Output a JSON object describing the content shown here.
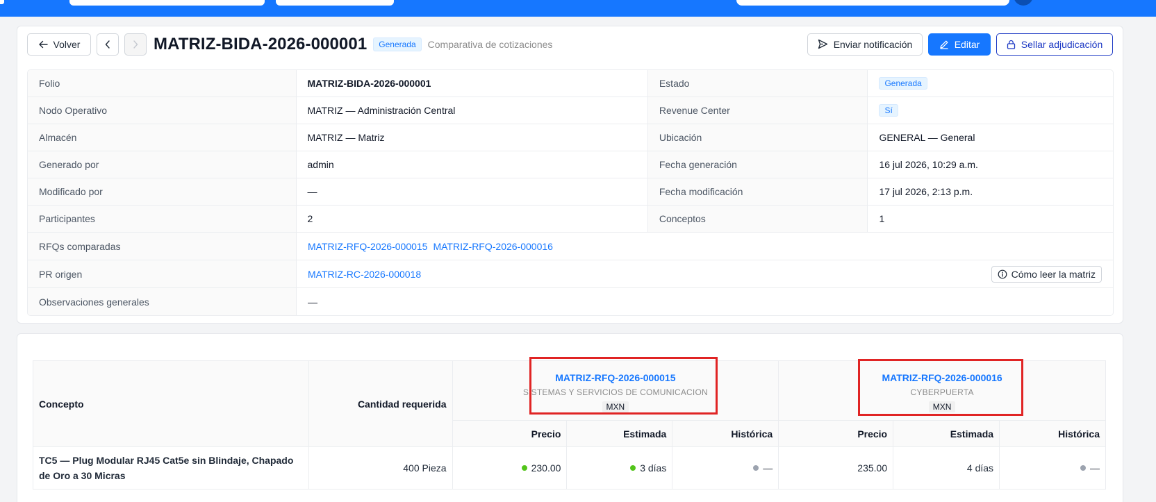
{
  "header": {
    "back_label": "Volver",
    "title": "MATRIZ-BIDA-2026-000001",
    "status": "Generada",
    "subtitle": "Comparativa de cotizaciones",
    "notify_label": "Enviar notificación",
    "edit_label": "Editar",
    "seal_label": "Sellar adjudicación"
  },
  "details": {
    "folio_label": "Folio",
    "folio": "MATRIZ-BIDA-2026-000001",
    "estado_label": "Estado",
    "estado": "Generada",
    "nodo_label": "Nodo Operativo",
    "nodo": "MATRIZ — Administración Central",
    "revenue_label": "Revenue Center",
    "revenue": "Sí",
    "almacen_label": "Almacén",
    "almacen": "MATRIZ — Matriz",
    "ubicacion_label": "Ubicación",
    "ubicacion": "GENERAL — General",
    "generado_label": "Generado por",
    "generado": "admin",
    "fecha_gen_label": "Fecha generación",
    "fecha_gen": "16 jul 2026, 10:29 a.m.",
    "modificado_label": "Modificado por",
    "modificado": "—",
    "fecha_mod_label": "Fecha modificación",
    "fecha_mod": "17 jul 2026, 2:13 p.m.",
    "participantes_label": "Participantes",
    "participantes": "2",
    "conceptos_label": "Conceptos",
    "conceptos": "1",
    "rfqs_label": "RFQs comparadas",
    "rfqs": [
      "MATRIZ-RFQ-2026-000015",
      "MATRIZ-RFQ-2026-000016"
    ],
    "pr_label": "PR origen",
    "pr": "MATRIZ-RC-2026-000018",
    "how_label": "Cómo leer la matriz",
    "obs_label": "Observaciones generales",
    "obs": "—"
  },
  "matrix": {
    "col_concept": "Concepto",
    "col_qty": "Cantidad requerida",
    "col_price": "Precio",
    "col_est": "Estimada",
    "col_hist": "Histórica",
    "suppliers": [
      {
        "rfq": "MATRIZ-RFQ-2026-000015",
        "vendor": "SISTEMAS Y SERVICIOS DE COMUNICACION",
        "currency": "MXN"
      },
      {
        "rfq": "MATRIZ-RFQ-2026-000016",
        "vendor": "CYBERPUERTA",
        "currency": "MXN"
      }
    ],
    "rows": [
      {
        "concept": "TC5 — Plug Modular RJ45 Cat5e sin Blindaje, Chapado de Oro a 30 Micras",
        "qty": "400 Pieza",
        "s1_price": "230.00",
        "s1_est": "3 días",
        "s1_hist": "—",
        "s2_price": "235.00",
        "s2_est": "4 días",
        "s2_hist": "—"
      }
    ]
  },
  "colors": {
    "primary": "#1677ff",
    "best": "#52c41a",
    "neutral": "#9ca3af",
    "highlight": "#e02424"
  }
}
